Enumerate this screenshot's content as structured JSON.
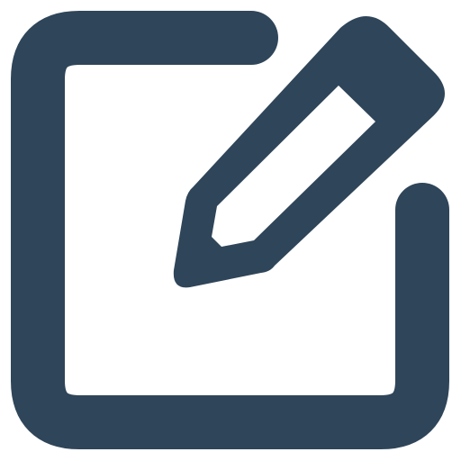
{
  "icon": {
    "name": "edit-icon",
    "color": "#2f4559",
    "background": "#ffffff"
  }
}
